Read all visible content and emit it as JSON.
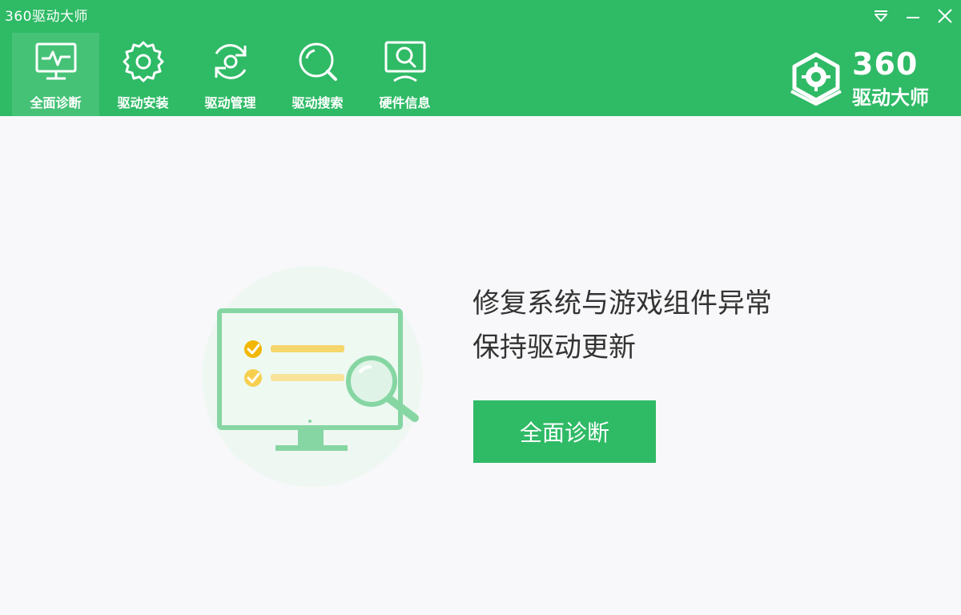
{
  "window": {
    "title": "360驱动大师",
    "controls": {
      "menu_icon": "dropdown-menu-icon",
      "minimize_icon": "minimize-icon",
      "close_icon": "close-icon"
    }
  },
  "toolbar": {
    "items": [
      {
        "label": "全面诊断",
        "icon": "monitor-pulse-icon",
        "active": true
      },
      {
        "label": "驱动安装",
        "icon": "gear-icon",
        "active": false
      },
      {
        "label": "驱动管理",
        "icon": "sync-gear-icon",
        "active": false
      },
      {
        "label": "驱动搜索",
        "icon": "search-icon",
        "active": false
      },
      {
        "label": "硬件信息",
        "icon": "monitor-search-icon",
        "active": false
      }
    ]
  },
  "brand": {
    "logo_icon": "360-gear-logo-icon",
    "line1": "360",
    "line2": "驱动大师"
  },
  "main": {
    "illustration_icon": "monitor-checklist-magnifier-icon",
    "headline_line1": "修复系统与游戏组件异常",
    "headline_line2": "保持驱动更新",
    "cta_label": "全面诊断"
  },
  "colors": {
    "brand_green": "#2fba66",
    "active_tab": "#46c277",
    "background": "#f8f8fa",
    "accent_yellow": "#f2b705"
  }
}
